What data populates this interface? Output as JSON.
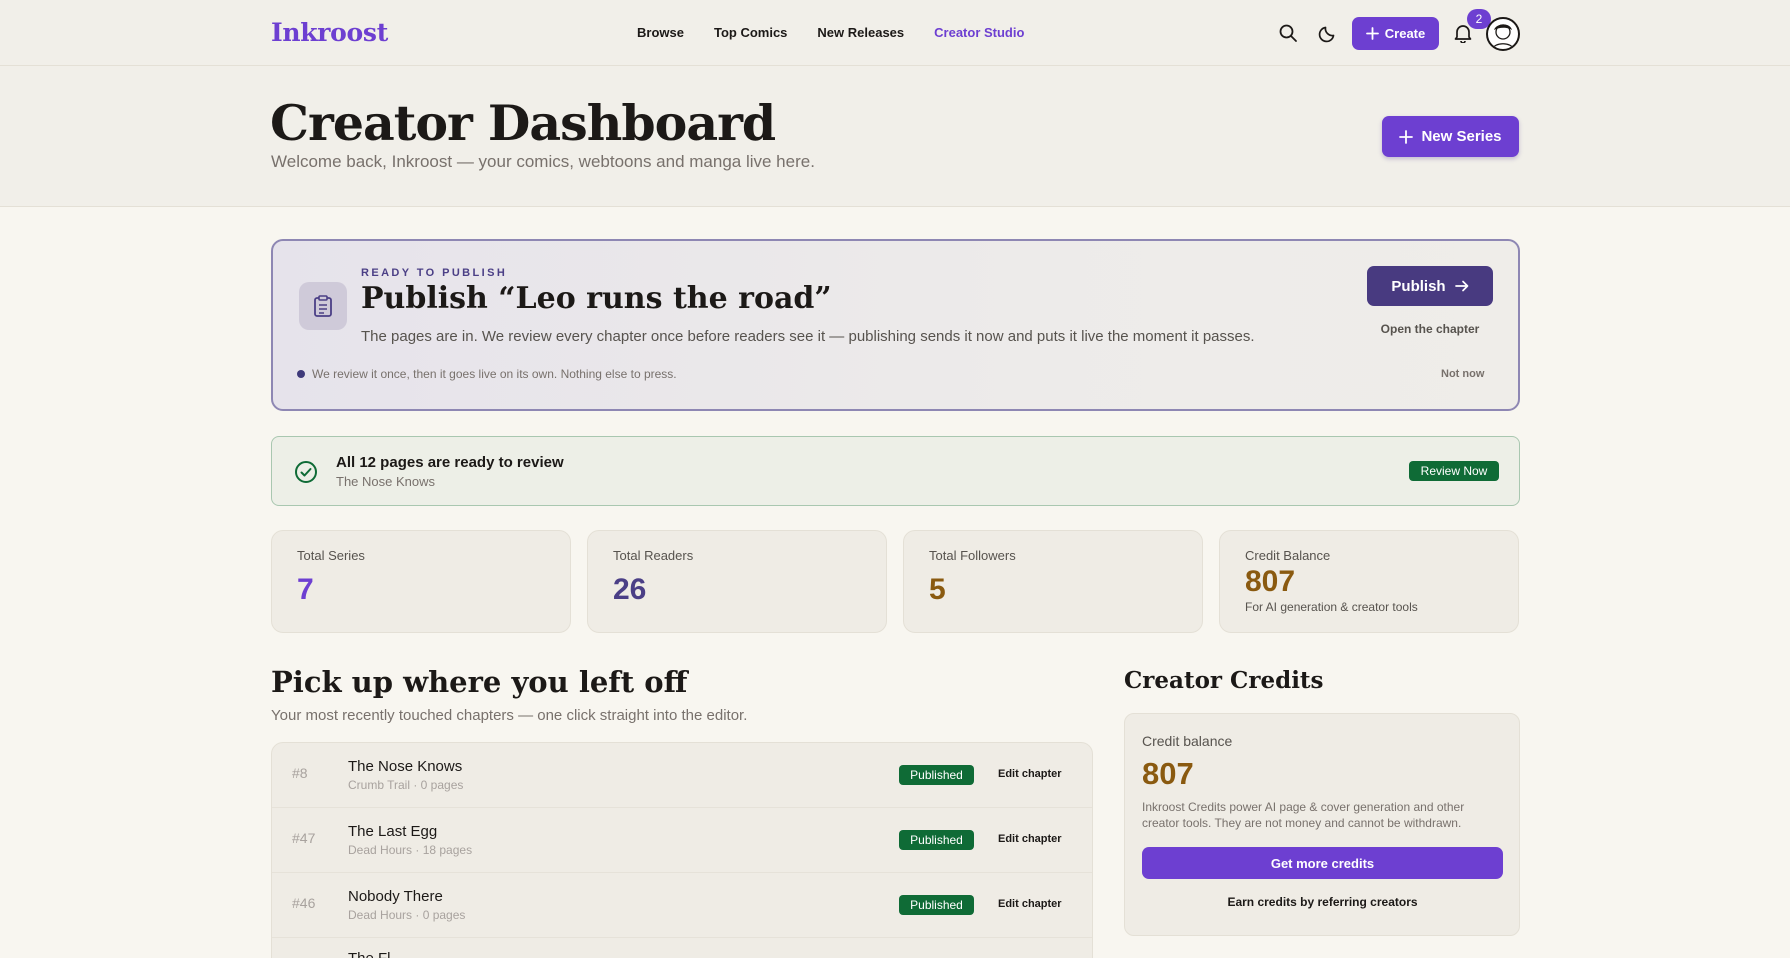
{
  "brand": {
    "name": "Inkroost",
    "accent": "#6d3fd1"
  },
  "nav": {
    "items": [
      "Browse",
      "Top Comics",
      "New Releases",
      "Creator Studio"
    ],
    "active": "Creator Studio",
    "create_label": "Create",
    "notification_count": "2",
    "icons": [
      "search-icon",
      "moon-icon",
      "plus-icon",
      "bell-icon"
    ]
  },
  "header": {
    "title": "Creator Dashboard",
    "subtitle": "Welcome back, Inkroost — your comics, webtoons and manga live here.",
    "new_series_label": "New Series"
  },
  "publish_card": {
    "eyebrow": "READY TO PUBLISH",
    "title": "Publish “Leo runs the road”",
    "description": "The pages are in. We review every chapter once before readers see it — publishing sends it now and puts it live the moment it passes.",
    "note": "We review it once, then it goes live on its own. Nothing else to press.",
    "publish_label": "Publish",
    "open_label": "Open the chapter",
    "dismiss_label": "Not now"
  },
  "review_banner": {
    "title": "All 12 pages are ready to review",
    "subtitle": "The Nose Knows",
    "action_label": "Review Now",
    "color": "#0f6b36"
  },
  "stats": [
    {
      "label": "Total Series",
      "value": "7",
      "color": "#6d3fd1"
    },
    {
      "label": "Total Readers",
      "value": "26",
      "color": "#4b3f86"
    },
    {
      "label": "Total Followers",
      "value": "5",
      "color": "#8a5a10"
    },
    {
      "label": "Credit Balance",
      "value": "807",
      "color": "#8a5a10",
      "footnote": "For AI generation & creator tools"
    }
  ],
  "recent": {
    "title": "Pick up where you left off",
    "subtitle": "Your most recently touched chapters — one click straight into the editor.",
    "rows": [
      {
        "number": "#8",
        "title": "The Nose Knows",
        "meta": "Crumb Trail · 0 pages",
        "status": "Published",
        "action": "Edit chapter"
      },
      {
        "number": "#47",
        "title": "The Last Egg",
        "meta": "Dead Hours · 18 pages",
        "status": "Published",
        "action": "Edit chapter"
      },
      {
        "number": "#46",
        "title": "Nobody There",
        "meta": "Dead Hours · 0 pages",
        "status": "Published",
        "action": "Edit chapter"
      },
      {
        "number": "",
        "title": "The Fl",
        "meta": "",
        "status": "",
        "action": ""
      }
    ]
  },
  "credits": {
    "title": "Creator Credits",
    "label": "Credit balance",
    "value": "807",
    "description": "Inkroost Credits power AI page & cover generation and other creator tools. They are not money and cannot be withdrawn.",
    "primary_action": "Get more credits",
    "secondary_action": "Earn credits by referring creators"
  }
}
